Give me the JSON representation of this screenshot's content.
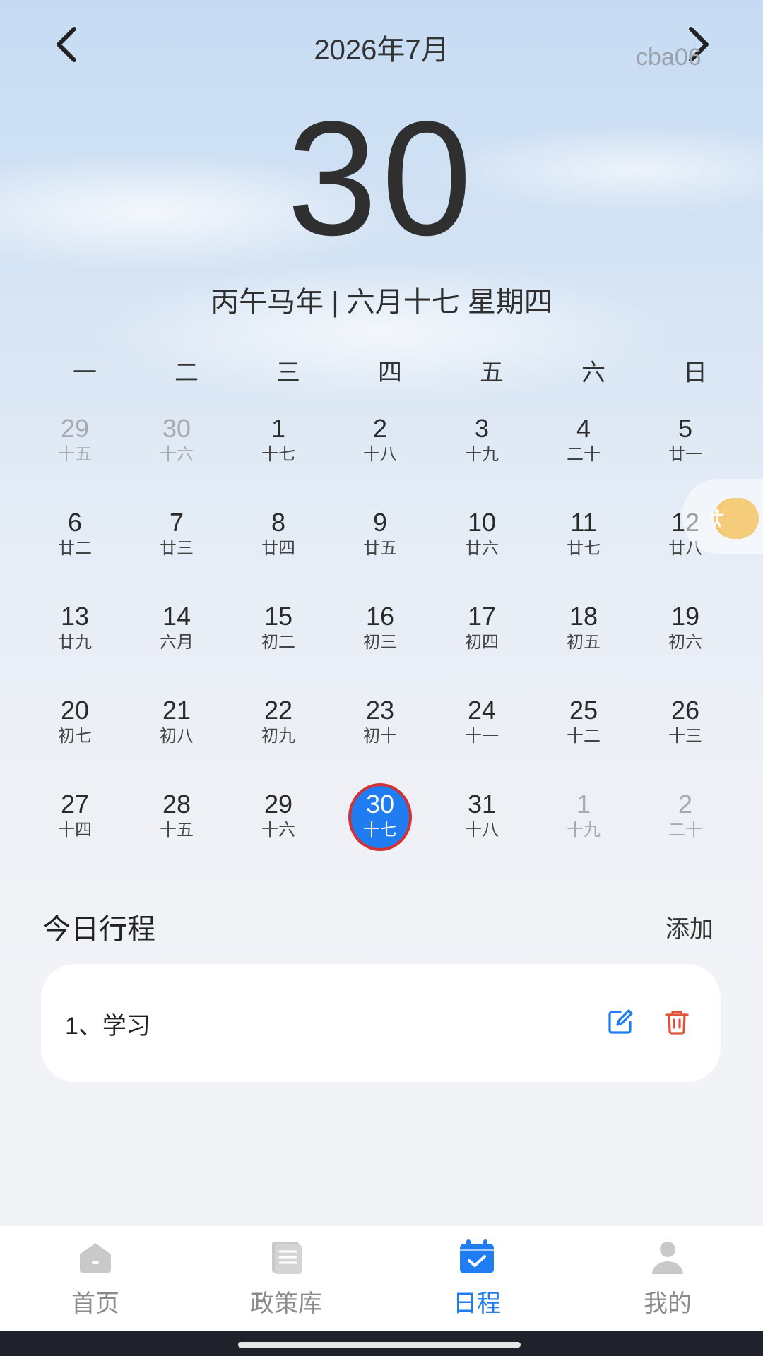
{
  "header": {
    "month_title": "2026年7月",
    "watermark": "cba06",
    "big_day": "30",
    "lunar_line": "丙午马年 | 六月十七 星期四"
  },
  "weekdays": [
    "一",
    "二",
    "三",
    "四",
    "五",
    "六",
    "日"
  ],
  "calendar": {
    "days": [
      {
        "n": "29",
        "l": "十五",
        "muted": true
      },
      {
        "n": "30",
        "l": "十六",
        "muted": true
      },
      {
        "n": "1",
        "l": "十七"
      },
      {
        "n": "2",
        "l": "十八"
      },
      {
        "n": "3",
        "l": "十九"
      },
      {
        "n": "4",
        "l": "二十"
      },
      {
        "n": "5",
        "l": "廿一"
      },
      {
        "n": "6",
        "l": "廿二"
      },
      {
        "n": "7",
        "l": "廿三"
      },
      {
        "n": "8",
        "l": "廿四"
      },
      {
        "n": "9",
        "l": "廿五"
      },
      {
        "n": "10",
        "l": "廿六"
      },
      {
        "n": "11",
        "l": "廿七"
      },
      {
        "n": "12",
        "l": "廿八"
      },
      {
        "n": "13",
        "l": "廿九"
      },
      {
        "n": "14",
        "l": "六月"
      },
      {
        "n": "15",
        "l": "初二"
      },
      {
        "n": "16",
        "l": "初三"
      },
      {
        "n": "17",
        "l": "初四"
      },
      {
        "n": "18",
        "l": "初五"
      },
      {
        "n": "19",
        "l": "初六"
      },
      {
        "n": "20",
        "l": "初七"
      },
      {
        "n": "21",
        "l": "初八"
      },
      {
        "n": "22",
        "l": "初九"
      },
      {
        "n": "23",
        "l": "初十"
      },
      {
        "n": "24",
        "l": "十一"
      },
      {
        "n": "25",
        "l": "十二"
      },
      {
        "n": "26",
        "l": "十三"
      },
      {
        "n": "27",
        "l": "十四"
      },
      {
        "n": "28",
        "l": "十五"
      },
      {
        "n": "29",
        "l": "十六"
      },
      {
        "n": "30",
        "l": "十七",
        "selected": true
      },
      {
        "n": "31",
        "l": "十八"
      },
      {
        "n": "1",
        "l": "十九",
        "muted": true
      },
      {
        "n": "2",
        "l": "二十",
        "muted": true
      }
    ]
  },
  "schedule": {
    "title": "今日行程",
    "add_label": "添加",
    "items": [
      {
        "text": "1、学习"
      }
    ]
  },
  "colors": {
    "accent": "#1f7cf1",
    "selected_ring": "#d23232",
    "delete": "#e0533a"
  },
  "tabs": [
    {
      "label": "首页",
      "icon": "home-icon"
    },
    {
      "label": "政策库",
      "icon": "policy-library-icon"
    },
    {
      "label": "日程",
      "icon": "calendar-icon",
      "active": true
    },
    {
      "label": "我的",
      "icon": "user-icon"
    }
  ]
}
